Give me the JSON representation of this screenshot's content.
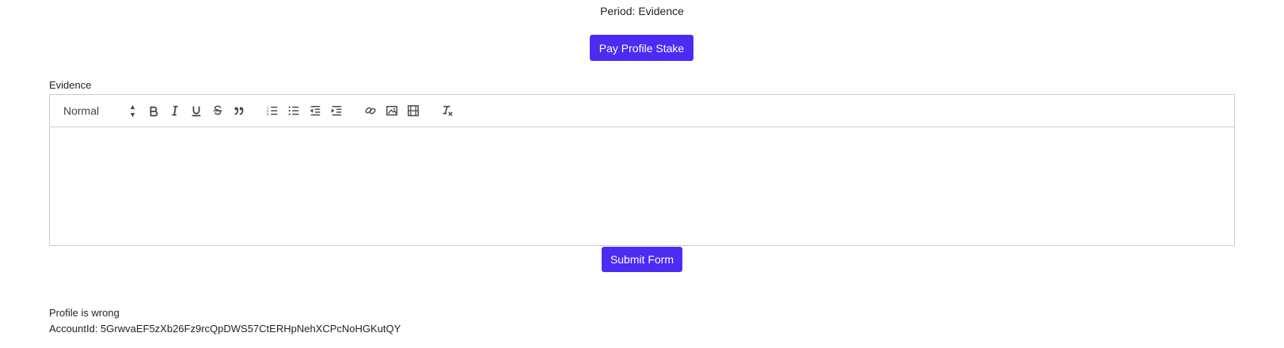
{
  "period": "Period: Evidence",
  "pay_button_label": "Pay Profile Stake",
  "evidence_label": "Evidence",
  "editor": {
    "format_select": "Normal",
    "toolbar_icons": [
      "bold-icon",
      "italic-icon",
      "underline-icon",
      "strikethrough-icon",
      "blockquote-icon",
      "ordered-list-icon",
      "bullet-list-icon",
      "outdent-icon",
      "indent-icon",
      "link-icon",
      "image-icon",
      "video-icon",
      "clear-format-icon"
    ],
    "body": ""
  },
  "submit_button_label": "Submit Form",
  "profile_status": "Profile is wrong",
  "account_id": "AccountId: 5GrwvaEF5zXb26Fz9rcQpDWS57CtERHpNehXCPcNoHGKutQY",
  "colors": {
    "accent": "#4a2cf5",
    "border": "#cccccc",
    "icon": "#444444"
  }
}
